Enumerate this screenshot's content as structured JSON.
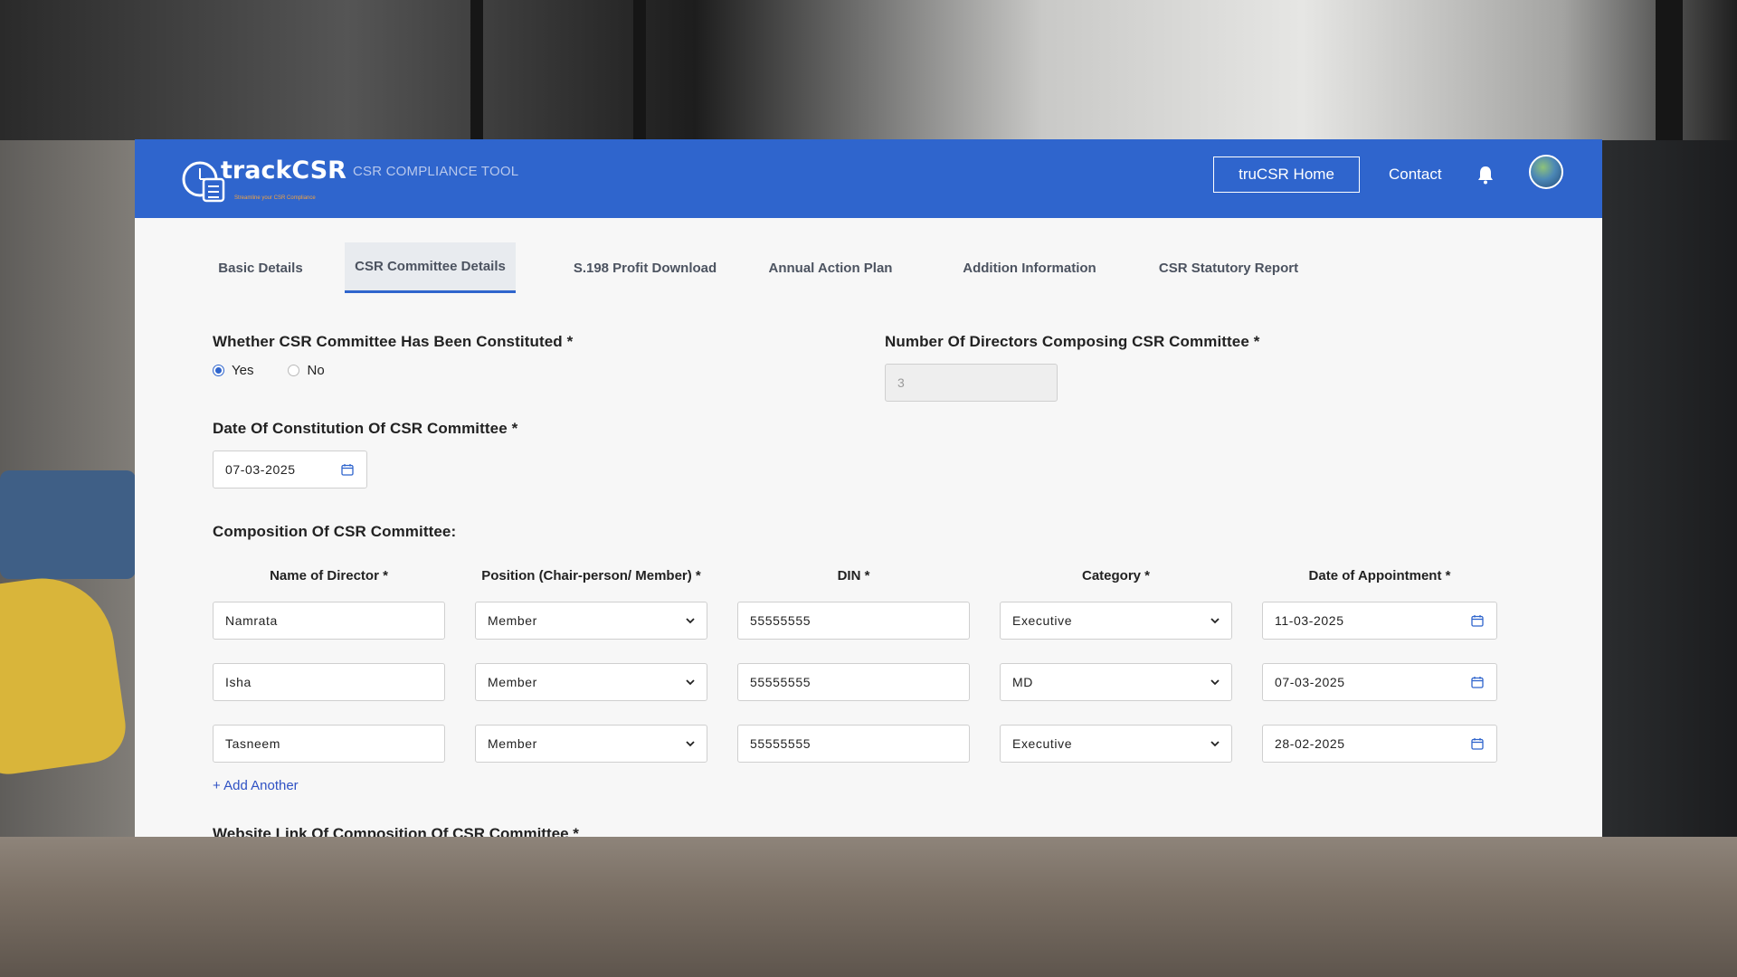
{
  "header": {
    "logo_text": "trackCSR",
    "logo_tagline": "Streamline your CSR Compliance",
    "tool_label": "CSR COMPLIANCE TOOL",
    "home_button": "truCSR Home",
    "contact": "Contact",
    "brand_color": "#2f65cd"
  },
  "tabs": [
    {
      "label": "Basic Details"
    },
    {
      "label": "CSR Committee Details",
      "active": true
    },
    {
      "label": "S.198 Profit Download"
    },
    {
      "label": "Annual Action Plan"
    },
    {
      "label": "Addition Information"
    },
    {
      "label": "CSR Statutory Report"
    }
  ],
  "form": {
    "constituted_label": "Whether CSR Committee Has Been Constituted *",
    "yes_label": "Yes",
    "no_label": "No",
    "selected": "Yes",
    "directors_count_label": "Number Of Directors Composing CSR Committee *",
    "directors_count_value": "3",
    "date_label": "Date Of Constitution Of CSR Committee *",
    "date_value": "07-03-2025",
    "composition_label": "Composition Of CSR Committee:",
    "columns": {
      "name": "Name of Director *",
      "position": "Position (Chair-person/ Member) *",
      "din": "DIN *",
      "category": "Category *",
      "appointment": "Date of Appointment *"
    },
    "rows": [
      {
        "name": "Namrata",
        "position": "Member",
        "din": "55555555",
        "category": "Executive",
        "date": "11-03-2025"
      },
      {
        "name": "Isha",
        "position": "Member",
        "din": "55555555",
        "category": "MD",
        "date": "07-03-2025"
      },
      {
        "name": "Tasneem",
        "position": "Member",
        "din": "55555555",
        "category": "Executive",
        "date": "28-02-2025"
      }
    ],
    "add_another": "+ Add Another",
    "next_label_cutoff": "Website Link Of Composition Of CSR Committee *"
  }
}
